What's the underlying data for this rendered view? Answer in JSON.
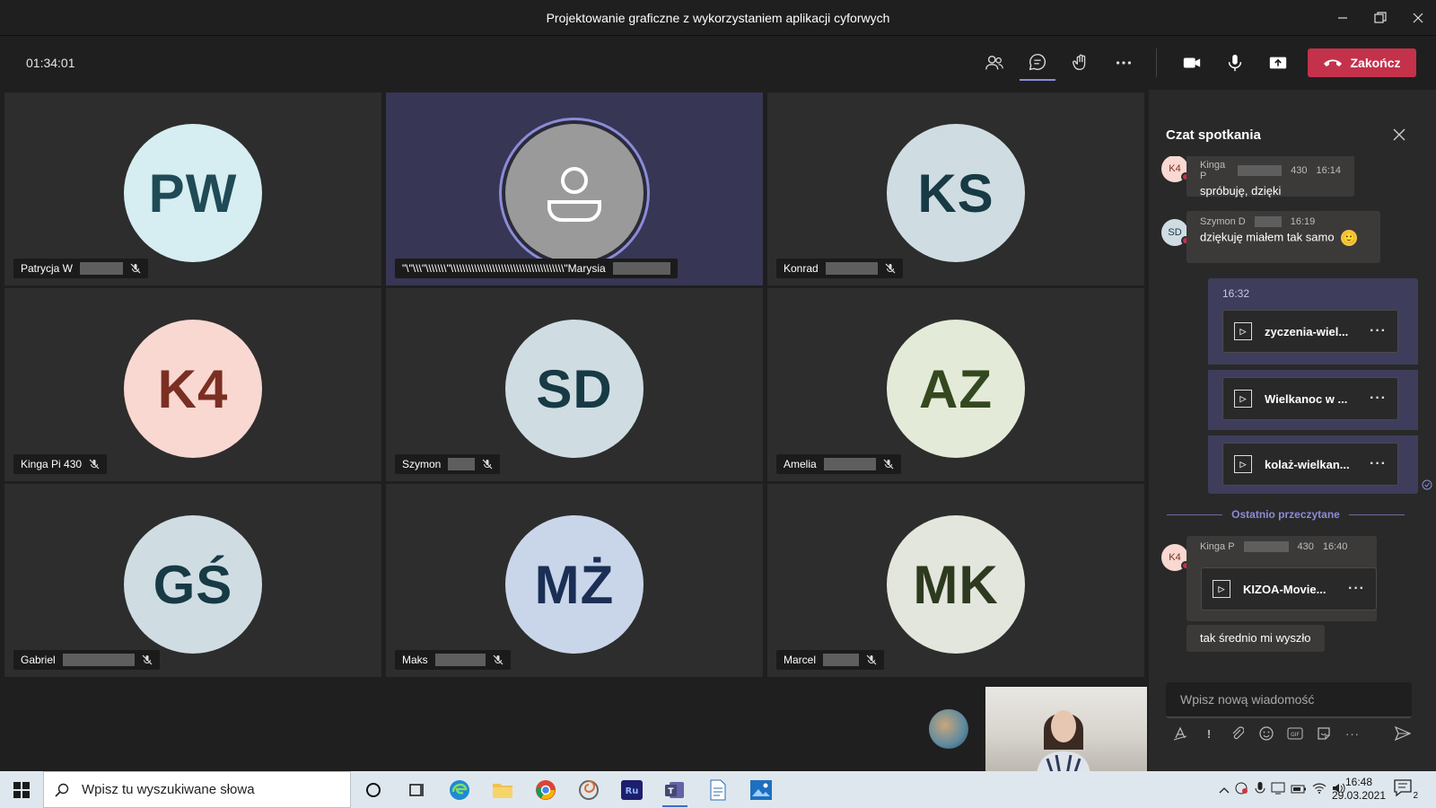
{
  "window": {
    "title": "Projektowanie graficzne z wykorzystaniem aplikacji cyforwych",
    "controls": [
      "minimize-icon",
      "restore-icon",
      "close-icon"
    ]
  },
  "call_bar": {
    "timer": "01:34:01",
    "end_label": "Zakończ",
    "buttons": [
      "people-icon",
      "chat-icon",
      "reactions-icon",
      "more-icon",
      "camera-icon",
      "mic-icon",
      "share-icon"
    ]
  },
  "participants": [
    {
      "initials": "PW",
      "name": "Patrycja W",
      "bg": "#d6eef1",
      "fg": "#1f4a56"
    },
    {
      "initials": "",
      "name": "\"\\\"\\\\\\\"\\\\\\\\\\\\\\\"\\\\\\\\\\\\\\\\\\\\\\\\\\\\\\\\\\\\\\\\\\\\\\\\\\\\\\\\\\\\\\\\\\\\\\\\\\\\\"Marysia",
      "bg": "#9a9a9a",
      "fg": "#ffffff",
      "active": true
    },
    {
      "initials": "KS",
      "name": "Konrad",
      "bg": "#cfdde3",
      "fg": "#173a44"
    },
    {
      "initials": "K4",
      "name": "Kinga Pi 430",
      "bg": "#f9d8d2",
      "fg": "#7a2f22"
    },
    {
      "initials": "SD",
      "name": "Szymon",
      "bg": "#cfdde3",
      "fg": "#173a44"
    },
    {
      "initials": "AZ",
      "name": "Amelia",
      "bg": "#e4ead8",
      "fg": "#34481f"
    },
    {
      "initials": "GŚ",
      "name": "Gabriel",
      "bg": "#cfdde3",
      "fg": "#173a44"
    },
    {
      "initials": "MŻ",
      "name": "Maks",
      "bg": "#c9d6ea",
      "fg": "#1b2f55"
    },
    {
      "initials": "MK",
      "name": "Marcel",
      "bg": "#e3e6dc",
      "fg": "#2e3a1f"
    }
  ],
  "chat": {
    "header": "Czat spotkania",
    "messages": [
      {
        "avatar": "K4",
        "author": "Kinga P",
        "author_suffix": "430",
        "time": "16:14",
        "text": "spróbuję, dzięki"
      },
      {
        "avatar": "SD",
        "author": "Szymon D",
        "author_suffix": "",
        "time": "16:19",
        "text": "dziękuję miałem tak samo",
        "emoji": "🙂"
      }
    ],
    "own_time": "16:32",
    "own_files": [
      "zyczenia-wiel...",
      "Wielkanoc w ...",
      "kolaż-wielkan..."
    ],
    "last_read_label": "Ostatnio przeczytane",
    "later_message": {
      "avatar": "K4",
      "author": "Kinga P",
      "author_suffix": "430",
      "time": "16:40",
      "file": "KIZOA-Movie...",
      "text": "tak średnio mi wyszło"
    },
    "compose_placeholder": "Wpisz nową wiadomość",
    "compose_tools": [
      "format-icon",
      "important-icon",
      "attach-icon",
      "emoji-icon",
      "gif-icon",
      "sticker-icon",
      "more-icon",
      "send-icon"
    ]
  },
  "taskbar": {
    "search_placeholder": "Wpisz tu wyszukiwane słowa",
    "time": "16:48",
    "date": "29.03.2021",
    "notification_count": "2"
  }
}
